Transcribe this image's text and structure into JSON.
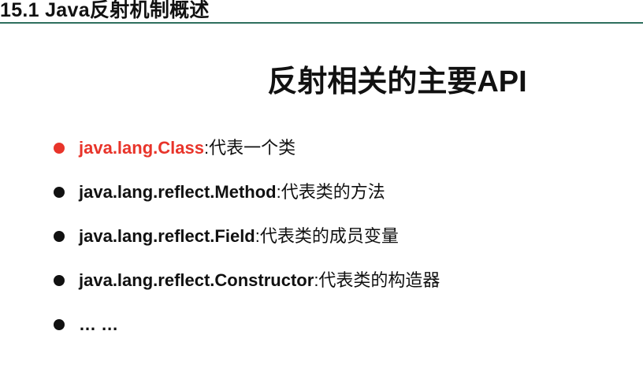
{
  "header": {
    "title": "15.1 Java反射机制概述"
  },
  "slide": {
    "title": "反射相关的主要API"
  },
  "bullets": [
    {
      "term": "java.lang.Class",
      "desc": ":代表一个类"
    },
    {
      "term": "java.lang.reflect.Method",
      "desc": ":代表类的方法"
    },
    {
      "term": "java.lang.reflect.Field",
      "desc": ":代表类的成员变量"
    },
    {
      "term": "java.lang.reflect.Constructor",
      "desc": ":代表类的构造器"
    },
    {
      "term": "… …",
      "desc": ""
    }
  ],
  "colors": {
    "header_rule": "#2e6f5e",
    "highlight": "#e8342a",
    "text": "#111111",
    "bullet_dot": "#111111"
  }
}
